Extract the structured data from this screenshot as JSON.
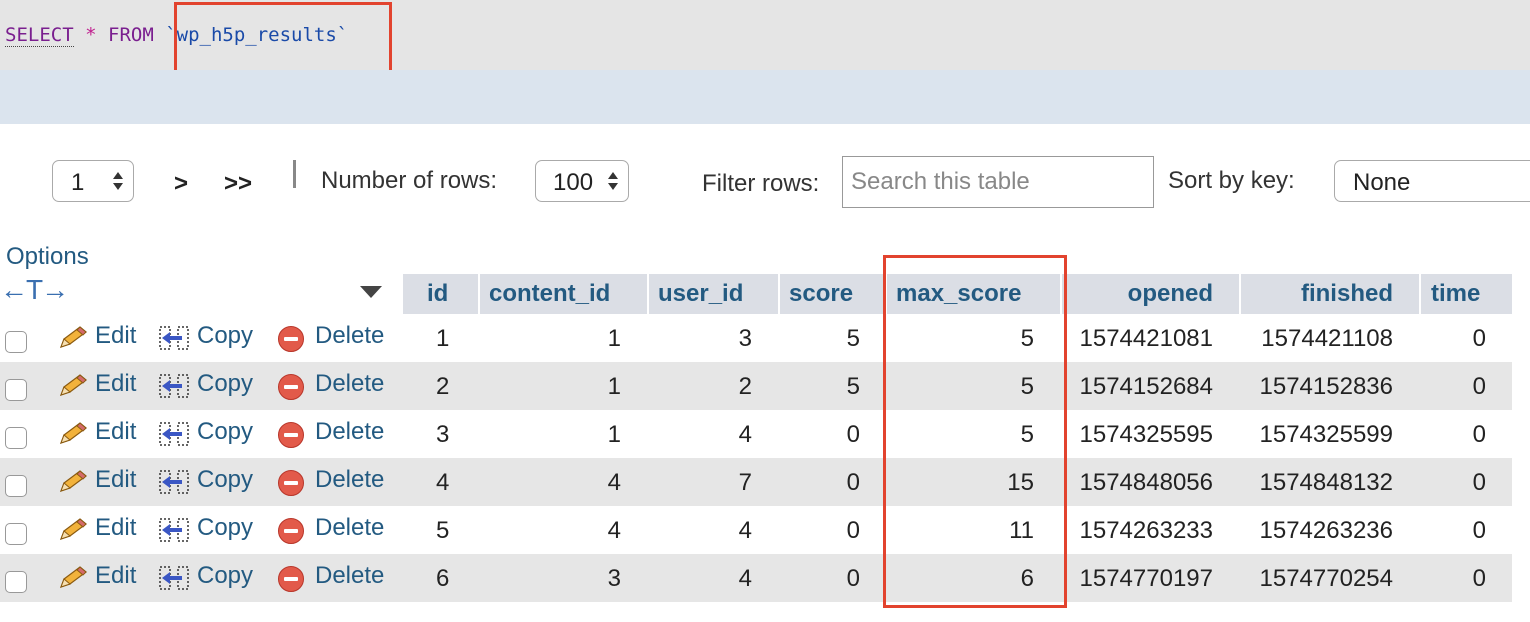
{
  "sql": {
    "select_kw": "SELECT",
    "star": "*",
    "from_kw": "FROM",
    "table": "`wp_h5p_results`"
  },
  "nav": {
    "page_value": "1",
    "next": ">",
    "last": ">>",
    "rows_label": "Number of rows:",
    "rows_value": "100",
    "filter_label": "Filter rows:",
    "filter_placeholder": "Search this table",
    "sortkey_label": "Sort by key:",
    "sortkey_value": "None"
  },
  "table": {
    "options_label": "Options",
    "headers": [
      "id",
      "content_id",
      "user_id",
      "score",
      "max_score",
      "opened",
      "finished",
      "time"
    ],
    "action_labels": {
      "edit": "Edit",
      "copy": "Copy",
      "delete": "Delete"
    },
    "rows": [
      [
        "1",
        "1",
        "3",
        "5",
        "5",
        "1574421081",
        "1574421108",
        "0"
      ],
      [
        "2",
        "1",
        "2",
        "5",
        "5",
        "1574152684",
        "1574152836",
        "0"
      ],
      [
        "3",
        "1",
        "4",
        "0",
        "5",
        "1574325595",
        "1574325599",
        "0"
      ],
      [
        "4",
        "4",
        "7",
        "0",
        "15",
        "1574848056",
        "1574848132",
        "0"
      ],
      [
        "5",
        "4",
        "4",
        "0",
        "11",
        "1574263233",
        "1574263236",
        "0"
      ],
      [
        "6",
        "3",
        "4",
        "0",
        "6",
        "1574770197",
        "1574770254",
        "0"
      ]
    ]
  },
  "colors": {
    "link": "#235a81",
    "highlight": "#e2432e",
    "row_alt": "#e6e6e6",
    "header_bg": "#dbdee5"
  }
}
